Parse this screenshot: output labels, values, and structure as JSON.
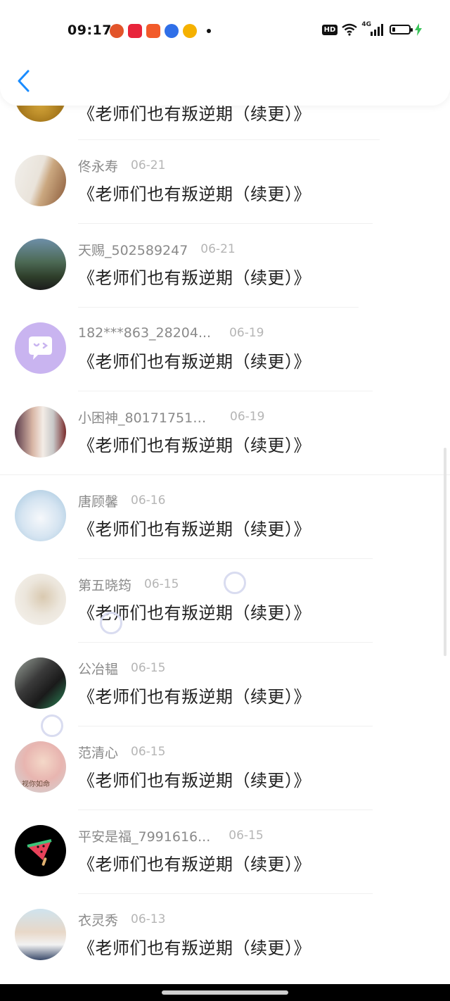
{
  "status_bar": {
    "time": "09:17",
    "hd_badge": "HD",
    "network": "4G"
  },
  "header": {
    "back_icon": "chevron-left-icon"
  },
  "list": {
    "top_partial_content": "《老师们也有叛逆期（续更）》",
    "items": [
      {
        "name": "佟永寿",
        "date": "06-21",
        "content": "《老师们也有叛逆期（续更）》"
      },
      {
        "name": "天赐_502589247",
        "date": "06-21",
        "content": "《老师们也有叛逆期（续更）》"
      },
      {
        "name": "182***863_28204...",
        "date": "06-19",
        "content": "《老师们也有叛逆期（续更）》"
      },
      {
        "name": "小困神_801717516...",
        "date": "06-19",
        "content": "《老师们也有叛逆期（续更）》"
      },
      {
        "name": "唐顾馨",
        "date": "06-16",
        "content": "《老师们也有叛逆期（续更）》"
      },
      {
        "name": "第五晓筠",
        "date": "06-15",
        "content": "《老师们也有叛逆期（续更）》"
      },
      {
        "name": "公冶韫",
        "date": "06-15",
        "content": "《老师们也有叛逆期（续更）》"
      },
      {
        "name": "范清心",
        "date": "06-15",
        "content": "《老师们也有叛逆期（续更）》"
      },
      {
        "name": "平安是福_7991616...",
        "date": "06-15",
        "content": "《老师们也有叛逆期（续更）》"
      },
      {
        "name": "衣灵秀",
        "date": "06-13",
        "content": "《老师们也有叛逆期（续更）》"
      }
    ]
  },
  "avatar_overlay_text": "视你如命",
  "colors": {
    "accent": "#1a8cff",
    "name_gray": "#8a8a8a",
    "date_gray": "#b5b5b5",
    "default_avatar": "#c9b4f0"
  }
}
